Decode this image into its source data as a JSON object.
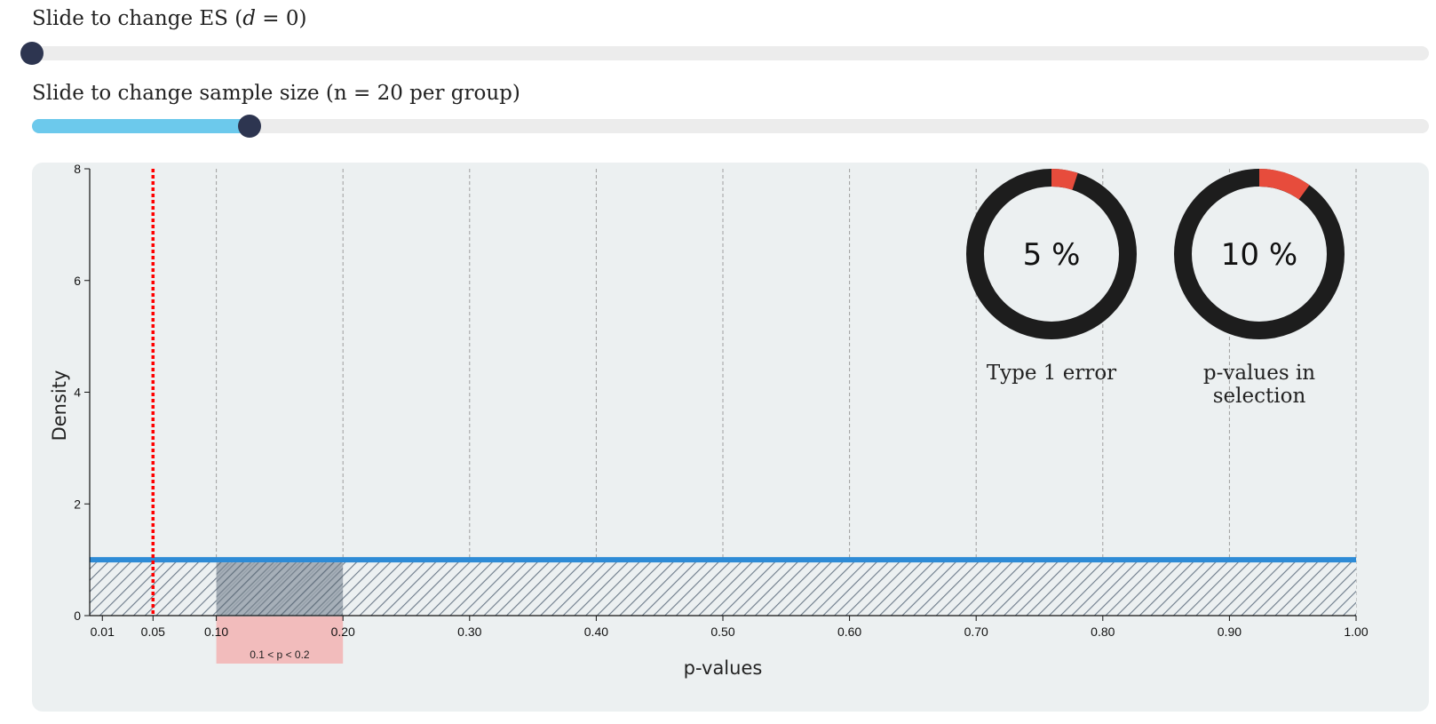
{
  "controls": {
    "es_label_prefix": "Slide to change ES (",
    "es_label_var": "d",
    "es_label_suffix": " = 0)",
    "es_value": 0,
    "es_slider_position": 0,
    "n_label": "Slide to change sample size (n = 20 per group)",
    "n_value": 20,
    "n_slider_position": 0.156
  },
  "colors": {
    "density_line": "#2e8bd6",
    "alpha_line": "#ff0000",
    "selection_box": "#f2bcbc",
    "donut_track": "#1d1d1d",
    "donut_fill": "#e74c3c",
    "slider_fill": "#6cc9ec",
    "slider_thumb": "#2d3550"
  },
  "chart_data": {
    "type": "area",
    "xlabel": "p-values",
    "ylabel": "Density",
    "xlim": [
      0,
      1
    ],
    "ylim": [
      0,
      8
    ],
    "x_ticks": [
      0.01,
      0.05,
      0.1,
      0.2,
      0.3,
      0.4,
      0.5,
      0.6,
      0.7,
      0.8,
      0.9,
      1.0
    ],
    "x_tick_labels": [
      "0.01",
      "0.05",
      "0.10",
      "0.20",
      "0.30",
      "0.40",
      "0.50",
      "0.60",
      "0.70",
      "0.80",
      "0.90",
      "1.00"
    ],
    "y_ticks": [
      0,
      2,
      4,
      6,
      8
    ],
    "y_tick_labels": [
      "0",
      "2",
      "4",
      "6",
      "8"
    ],
    "grid_x": [
      0.1,
      0.2,
      0.3,
      0.4,
      0.5,
      0.6,
      0.7,
      0.8,
      0.9,
      1.0
    ],
    "series": [
      {
        "x": [
          0,
          1
        ],
        "values": [
          1,
          1
        ]
      }
    ],
    "alpha_line": 0.05,
    "selection": {
      "from": 0.1,
      "to": 0.2,
      "label": "0.1 < p < 0.2"
    },
    "donuts": [
      {
        "value": 5,
        "text": "5 %",
        "label": [
          "Type 1 error"
        ]
      },
      {
        "value": 10,
        "text": "10 %",
        "label": [
          "p-values in",
          "selection"
        ]
      }
    ]
  }
}
